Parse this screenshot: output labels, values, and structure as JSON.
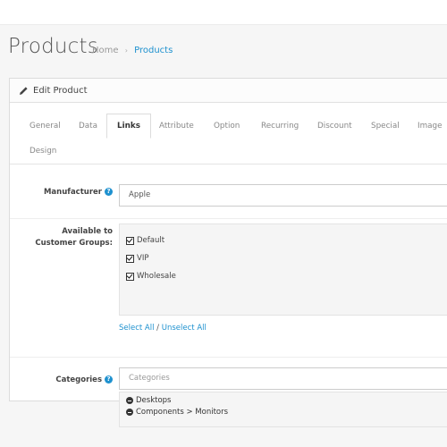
{
  "header": {
    "title": "Products",
    "breadcrumb": [
      {
        "label": "Home"
      },
      {
        "label": "Products"
      }
    ],
    "separator": "›"
  },
  "panel": {
    "heading": "Edit Product"
  },
  "tabs": [
    {
      "label": "General"
    },
    {
      "label": "Data"
    },
    {
      "label": "Links",
      "active": true
    },
    {
      "label": "Attribute"
    },
    {
      "label": "Option"
    },
    {
      "label": "Recurring"
    },
    {
      "label": "Discount"
    },
    {
      "label": "Special"
    },
    {
      "label": "Image"
    },
    {
      "label": "Design"
    }
  ],
  "form": {
    "manufacturer": {
      "label": "Manufacturer",
      "value": "Apple"
    },
    "customer_groups": {
      "label_line1": "Available to",
      "label_line2": "Customer Groups:",
      "options": [
        {
          "label": "Default",
          "checked": true
        },
        {
          "label": "VIP",
          "checked": true
        },
        {
          "label": "Wholesale",
          "checked": true
        }
      ],
      "select_all": "Select All",
      "divider": " / ",
      "unselect_all": "Unselect All"
    },
    "categories": {
      "label": "Categories",
      "placeholder": "Categories",
      "selected": [
        {
          "label": "Desktops"
        },
        {
          "label": "Components > Monitors"
        }
      ]
    }
  },
  "icons": {
    "help": "question-circle-icon",
    "edit": "pencil-icon",
    "remove": "minus-circle-icon"
  },
  "colors": {
    "accent": "#1e91cf"
  }
}
